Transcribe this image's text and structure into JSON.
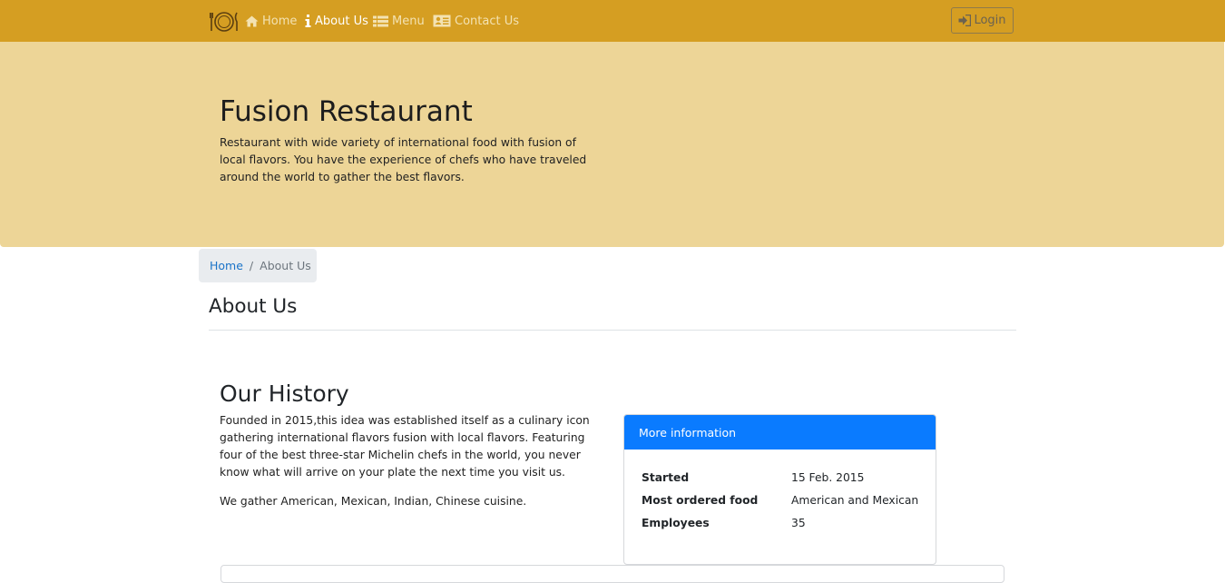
{
  "navbar": {
    "brand_icon": "plate-cutlery-icon",
    "items": [
      {
        "label": "Home",
        "icon": "home-icon",
        "active": false
      },
      {
        "label": "About Us",
        "icon": "info-icon",
        "active": true
      },
      {
        "label": "Menu",
        "icon": "list-icon",
        "active": false
      },
      {
        "label": "Contact Us",
        "icon": "address-card-icon",
        "active": false
      }
    ],
    "login_label": "Login",
    "colors": {
      "background": "#d59e22",
      "text": "#f3e2b2",
      "active": "#ffffff"
    }
  },
  "jumbotron": {
    "title": "Fusion Restaurant",
    "text": "Restaurant with wide variety of international food with fusion of local flavors. You have the experience of chefs who have traveled around the world to gather the best flavors.",
    "background": "#edd597"
  },
  "breadcrumb": {
    "home": "Home",
    "separator": "/",
    "current": "About Us"
  },
  "page_title": "About Us",
  "history": {
    "title": "Our History",
    "paragraph1": "Founded in 2015,this idea was established itself as a culinary icon gathering international flavors fusion with local flavors. Featuring four of the best three-star Michelin chefs in the world, you never know what will arrive on your plate the next time you visit us.",
    "paragraph2": "We gather American, Mexican, Indian, Chinese cuisine."
  },
  "info_card": {
    "header": "More information",
    "header_color": "#0a7bff",
    "rows": [
      {
        "label": "Started",
        "value": "15 Feb. 2015"
      },
      {
        "label": "Most ordered food",
        "value": "American and Mexican"
      },
      {
        "label": "Employees",
        "value": "35"
      }
    ]
  }
}
